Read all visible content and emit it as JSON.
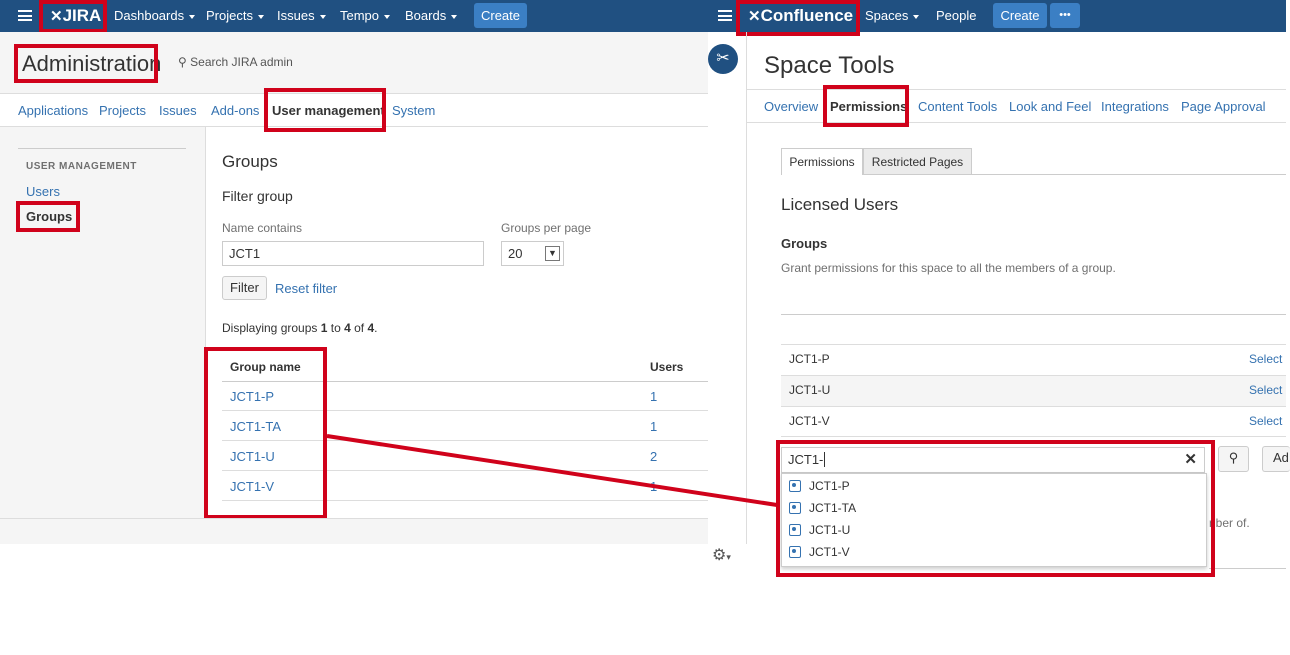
{
  "jira": {
    "logo": "JIRA",
    "nav": [
      "Dashboards",
      "Projects",
      "Issues",
      "Tempo",
      "Boards"
    ],
    "create": "Create",
    "page_title": "Administration",
    "search_placeholder": "Search JIRA admin",
    "tabs": [
      "Applications",
      "Projects",
      "Issues",
      "Add-ons",
      "User management",
      "System"
    ],
    "sidebar": {
      "section": "USER MANAGEMENT",
      "items": [
        "Users",
        "Groups"
      ]
    },
    "groups": {
      "title": "Groups",
      "filter_title": "Filter group",
      "name_label": "Name contains",
      "name_value": "JCT1",
      "per_page_label": "Groups per page",
      "per_page_value": "20",
      "filter_btn": "Filter",
      "reset_link": "Reset filter",
      "display_prefix": "Displaying groups ",
      "from": "1",
      "to_word": " to ",
      "to": "4",
      "of_word": " of ",
      "total": "4",
      "period": ".",
      "col_name": "Group name",
      "col_users": "Users",
      "rows": [
        {
          "name": "JCT1-P",
          "users": "1"
        },
        {
          "name": "JCT1-TA",
          "users": "1"
        },
        {
          "name": "JCT1-U",
          "users": "2"
        },
        {
          "name": "JCT1-V",
          "users": "1"
        }
      ]
    }
  },
  "confluence": {
    "logo": "Confluence",
    "nav": [
      "Spaces",
      "People"
    ],
    "create": "Create",
    "more": "•••",
    "title": "Space Tools",
    "tabs": [
      "Overview",
      "Permissions",
      "Content Tools",
      "Look and Feel",
      "Integrations",
      "Page Approval"
    ],
    "subtabs": [
      "Permissions",
      "Restricted Pages"
    ],
    "licensed": "Licensed Users",
    "groups_title": "Groups",
    "groups_desc": "Grant permissions for this space to all the members of a group.",
    "rows": [
      {
        "name": "JCT1-P",
        "action": "Select"
      },
      {
        "name": "JCT1-U",
        "action": "Select"
      },
      {
        "name": "JCT1-V",
        "action": "Select"
      }
    ],
    "search_value": "JCT1-",
    "add_btn": "Ad",
    "suggestions": [
      "JCT1-P",
      "JCT1-TA",
      "JCT1-U",
      "JCT1-V"
    ],
    "trailing_text": "nber of."
  },
  "colors": {
    "header": "#205081",
    "link": "#3572b0",
    "highlight": "#d0021b"
  }
}
